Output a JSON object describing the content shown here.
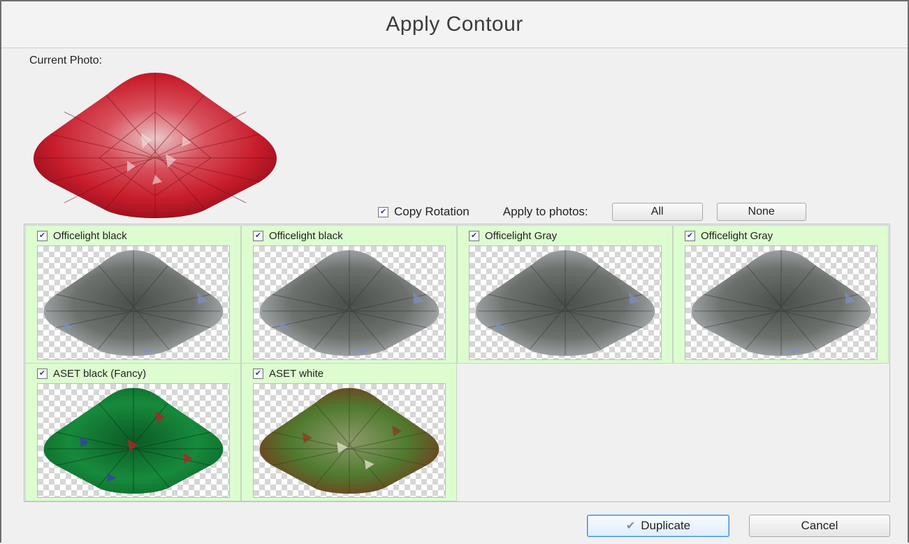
{
  "dialog": {
    "title": "Apply Contour"
  },
  "current_photo": {
    "label": "Current Photo:",
    "image": "red-cushion-gem"
  },
  "controls": {
    "copy_rotation_label": "Copy Rotation",
    "copy_rotation_checked": true,
    "apply_to_label": "Apply to photos:",
    "all_label": "All",
    "none_label": "None"
  },
  "photos": [
    {
      "label": "Officelight black",
      "checked": true,
      "image": "gray-cushion-gem"
    },
    {
      "label": "Officelight black",
      "checked": true,
      "image": "gray-cushion-gem"
    },
    {
      "label": "Officelight Gray",
      "checked": true,
      "image": "gray-cushion-gem"
    },
    {
      "label": "Officelight Gray",
      "checked": true,
      "image": "gray-cushion-gem"
    },
    {
      "label": "ASET black (Fancy)",
      "checked": true,
      "image": "green-cushion-gem"
    },
    {
      "label": "ASET white",
      "checked": true,
      "image": "olive-cushion-gem"
    }
  ],
  "footer": {
    "duplicate_label": "Duplicate",
    "duplicate_icon": "check-icon",
    "cancel_label": "Cancel"
  },
  "colors": {
    "cell_background": "#ddfdd1",
    "default_button_border": "#3d8ee0",
    "checkbox_mark": "#2d3da6"
  }
}
